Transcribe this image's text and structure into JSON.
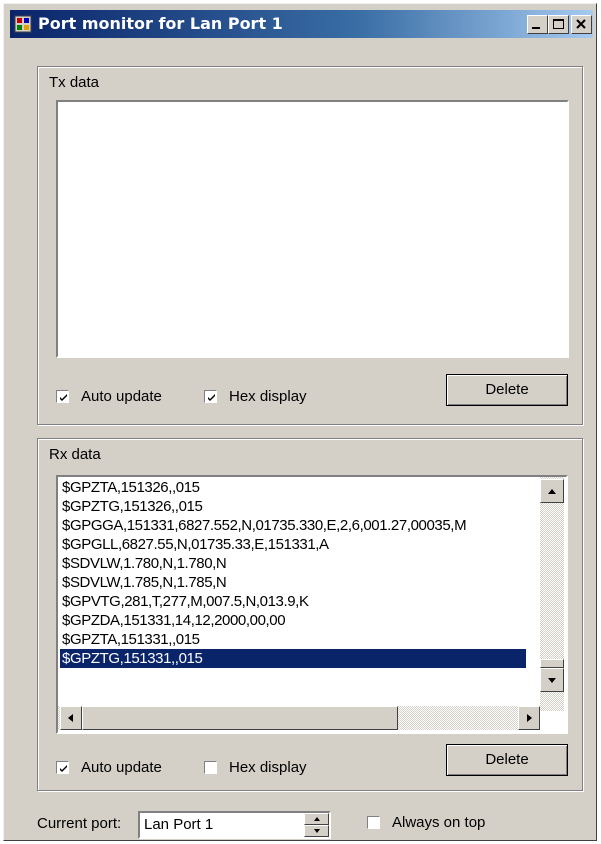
{
  "window": {
    "title": "Port monitor for Lan Port 1",
    "controls": {
      "minimize_icon": "minimize-icon",
      "maximize_icon": "maximize-icon",
      "close_icon": "close-icon"
    }
  },
  "tx": {
    "group_label": "Tx data",
    "auto_update_label": "Auto update",
    "auto_update_checked": true,
    "hex_display_label": "Hex display",
    "hex_display_checked": true,
    "delete_label": "Delete",
    "lines": []
  },
  "rx": {
    "group_label": "Rx data",
    "auto_update_label": "Auto update",
    "auto_update_checked": true,
    "hex_display_label": "Hex display",
    "hex_display_checked": false,
    "delete_label": "Delete",
    "selected_index": 9,
    "lines": [
      "$GPZTA,151326,,015",
      "$GPZTG,151326,,015",
      "$GPGGA,151331,6827.552,N,01735.330,E,2,6,001.27,00035,M",
      "$GPGLL,6827.55,N,01735.33,E,151331,A",
      "$SDVLW,1.780,N,1.780,N",
      "$SDVLW,1.785,N,1.785,N",
      "$GPVTG,281,T,277,M,007.5,N,013.9,K",
      "$GPZDA,151331,14,12,2000,00,00",
      "$GPZTA,151331,,015",
      "$GPZTG,151331,,015"
    ]
  },
  "footer": {
    "current_port_label": "Current port:",
    "current_port_value": "Lan Port 1",
    "always_on_top_label": "Always on top",
    "always_on_top_checked": false
  },
  "colors": {
    "title_start": "#0a246a",
    "title_end": "#a6caf0",
    "face": "#d4d0c8",
    "selection": "#0a246a"
  }
}
